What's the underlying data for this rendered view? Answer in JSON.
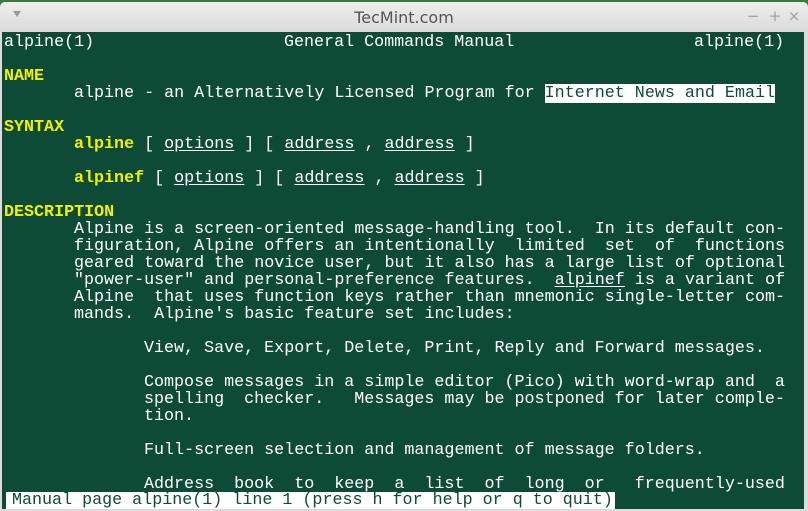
{
  "window": {
    "title": "TecMint.com",
    "menu_icon": "triangle-down-icon",
    "controls": {
      "minimize": "−",
      "maximize": "+",
      "close": "×"
    }
  },
  "colors": {
    "terminal_bg": "#0e4b37",
    "heading": "#f0f000",
    "text": "#ffffff"
  },
  "man": {
    "header_left": "alpine(1)",
    "header_center": "General Commands Manual",
    "header_right": "alpine(1)",
    "sections": {
      "name": {
        "heading": "NAME",
        "text_prefix": "alpine - an Alternatively Licensed Program for ",
        "text_highlight": "Internet News and Email"
      },
      "syntax": {
        "heading": "SYNTAX",
        "lines": [
          {
            "cmd": "alpine",
            "options": "options",
            "address1": "address",
            "address2": "address"
          },
          {
            "cmd": "alpinef",
            "options": "options",
            "address1": "address",
            "address2": "address"
          }
        ]
      },
      "description": {
        "heading": "DESCRIPTION",
        "para1": [
          "Alpine is a screen-oriented message-handling tool.  In its default con-",
          "figuration, Alpine offers an intentionally  limited  set  of  functions",
          "geared toward the novice user, but it also has a large list of optional",
          {
            "before": "\"power-user\" and personal-preference features.  ",
            "link": "alpinef",
            "after": " is a variant of"
          },
          "Alpine  that uses function keys rather than mnemonic single-letter com-",
          "mands.  Alpine's basic feature set includes:"
        ],
        "features": [
          "View, Save, Export, Delete, Print, Reply and Forward messages.",
          "Compose messages in a simple editor (Pico) with word-wrap and  a",
          "spelling  checker.   Messages may be postponed for later comple-",
          "tion.",
          "Full-screen selection and management of message folders.",
          "Address  book  to  keep  a  list  of  long  or   frequently-used"
        ]
      }
    },
    "status_line": "Manual page alpine(1) line 1 (press h for help or q to quit)"
  }
}
